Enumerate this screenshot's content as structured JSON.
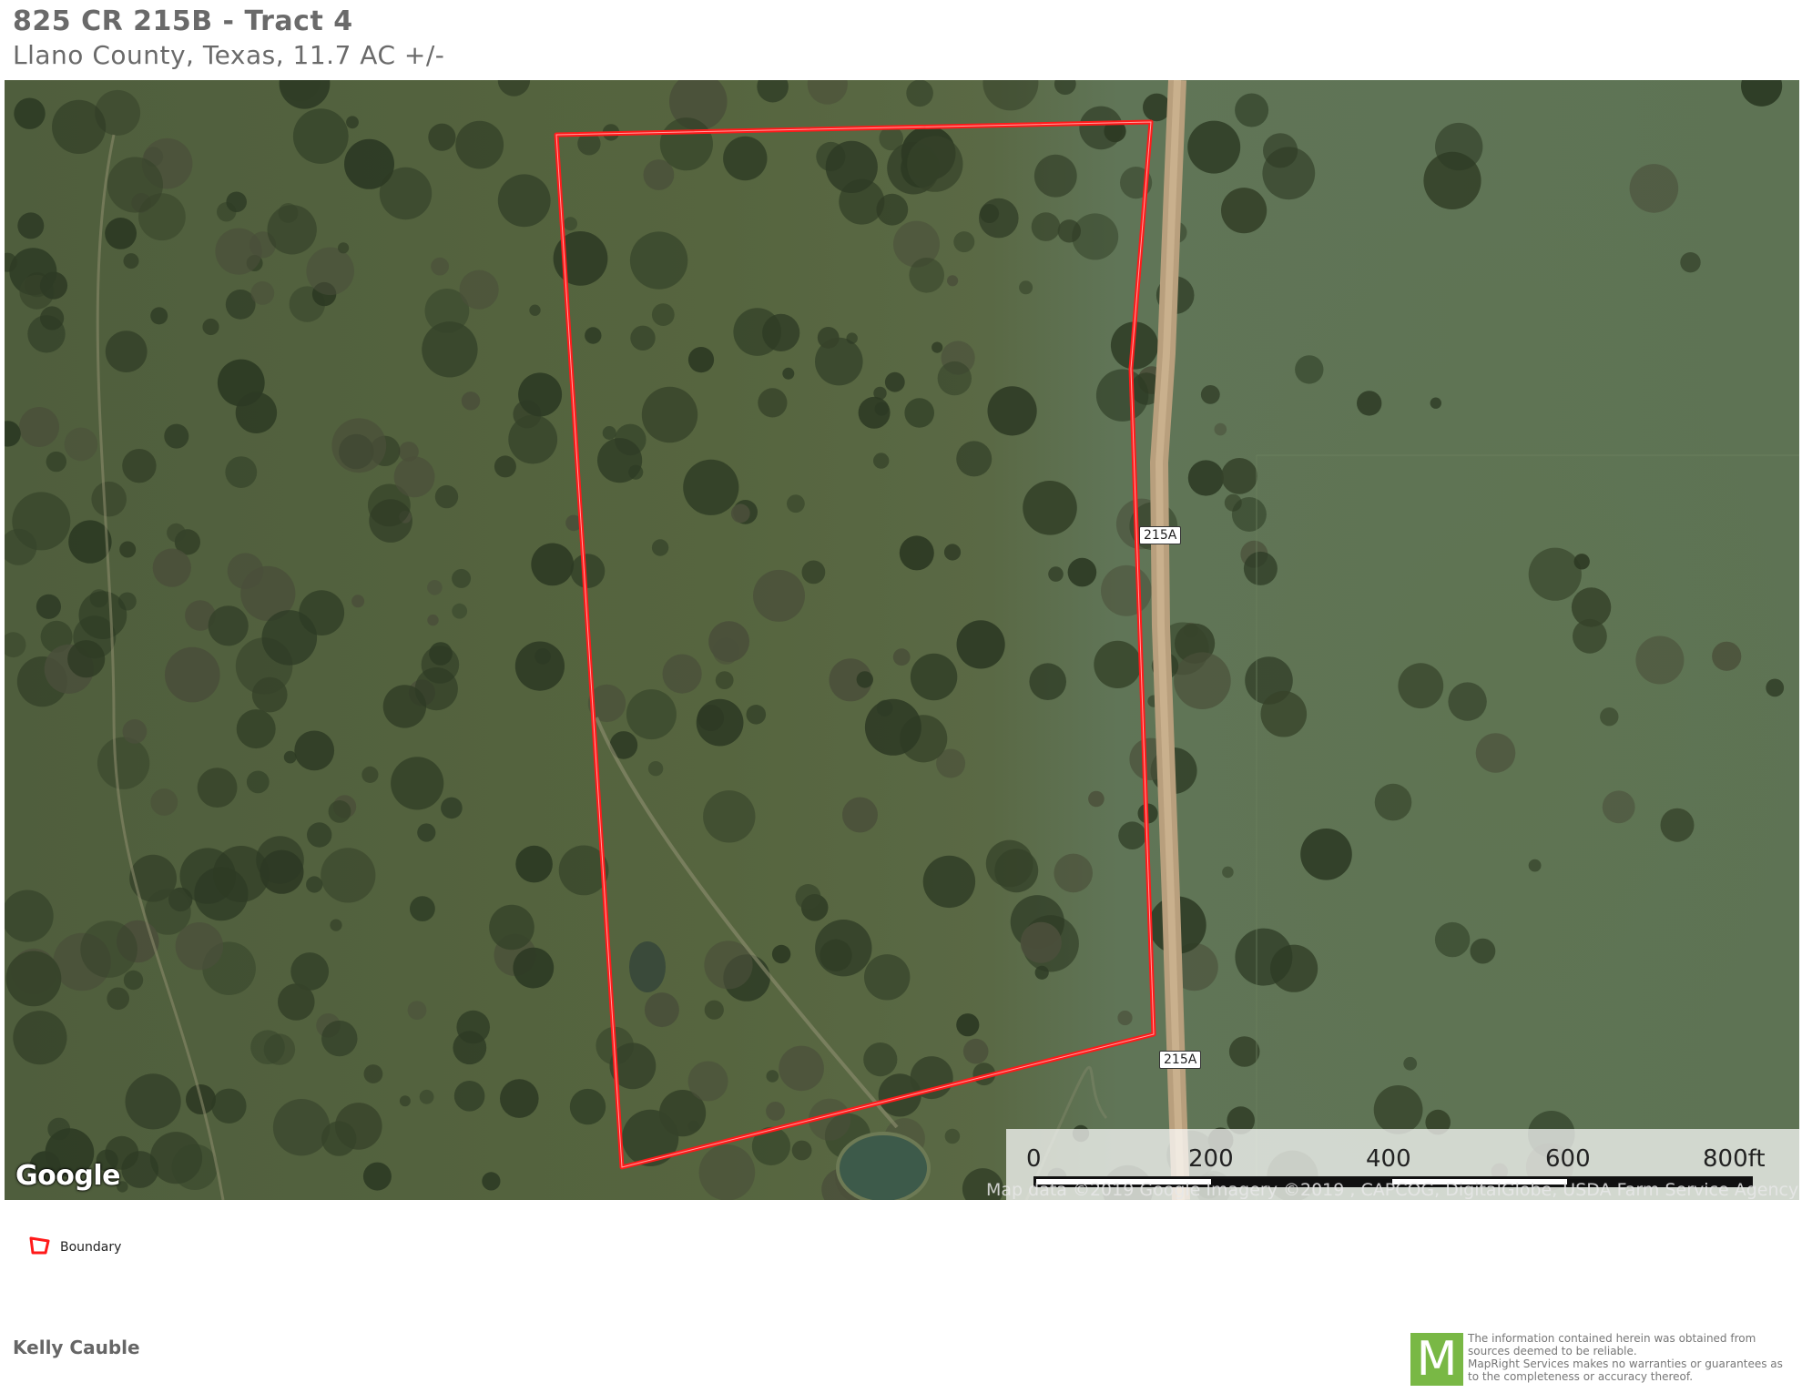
{
  "header": {
    "title": "825 CR 215B - Tract 4",
    "subtitle": "Llano County, Texas, 11.7 AC +/-"
  },
  "map": {
    "road_label_1": "215A",
    "road_label_2": "215A",
    "google_logo": "Google",
    "attribution": "Map data ©2019 Google  Imagery ©2019 , CAPCOG, DigitalGlobe, USDA Farm Service Agency",
    "scale": {
      "labels": [
        "0",
        "200",
        "400",
        "600",
        "800ft"
      ]
    },
    "boundary_color": "#ff1a1a"
  },
  "legend": {
    "boundary_label": "Boundary",
    "icon": "boundary-polygon-icon"
  },
  "footer": {
    "agent_name": "Kelly Cauble",
    "logo_letter": "M",
    "logo_icon": "mapright-logo-icon",
    "logo_color": "#79b845",
    "disclaimer_lines": [
      "The information contained herein was obtained from",
      "sources deemed to be reliable.",
      " MapRight Services makes no warranties or guarantees as",
      "to the completeness or accuracy thereof."
    ]
  }
}
